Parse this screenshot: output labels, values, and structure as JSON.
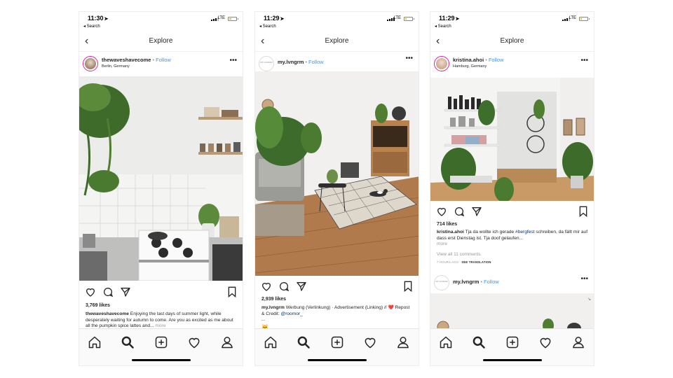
{
  "phones": [
    {
      "status": {
        "time": "11:30",
        "back_label": "◂ Search",
        "network": "LTE"
      },
      "nav": {
        "title": "Explore"
      },
      "post": {
        "username": "thewaveshavecome",
        "follow": "Follow",
        "location": "Berlin, Germany",
        "likes": "3,769 likes",
        "caption_user": "thewaveshavecome",
        "caption_text": "Enjoying the last days of summer light, while desperately waiting for autumn to come. Are you as excited as me about all the pumpkin spice lattes and...",
        "caption_more": "more"
      }
    },
    {
      "status": {
        "time": "11:29",
        "back_label": "◂ Search",
        "network": "LTE"
      },
      "nav": {
        "title": "Explore"
      },
      "post": {
        "username": "my.lvngrm",
        "follow": "Follow",
        "avatar_text": "MY LIVINGR",
        "likes": "2,939 likes",
        "caption_user": "my.lvngrm",
        "caption_text": "Werbung (Verlinkung) · Advertisement (Linking) // ❤️ Repost & Credit:",
        "caption_link": "@roomor_",
        "caption_ellipsis": "...",
        "emoji": "🐱"
      }
    },
    {
      "status": {
        "time": "11:29",
        "back_label": "◂ Search",
        "network": "LTE"
      },
      "nav": {
        "title": "Explore"
      },
      "post": {
        "username": "kristina.ahoi",
        "follow": "Follow",
        "location": "Hamburg, Germany",
        "likes": "714 likes",
        "caption_user": "kristina.ahoi",
        "caption_text_a": "Tja da wollte ich gerade",
        "caption_hashtag": "#bergfest",
        "caption_text_b": "schreiben, da fällt mir auf dass erst Dienstag ist. Tja doof gelaufen...",
        "caption_more": "more",
        "view_comments": "View all 11 comments",
        "time_ago": "7 HOURS AGO",
        "see_translation": "SEE TRANSLATION"
      },
      "next_post": {
        "username": "my.lvngrm",
        "follow": "Follow",
        "avatar_text": "MY LIVINGR"
      }
    }
  ],
  "tabbar": {
    "icons": [
      "home-icon",
      "search-icon",
      "new-post-icon",
      "activity-heart-icon",
      "profile-icon"
    ]
  },
  "colors": {
    "follow_blue": "#3897f0",
    "heart_red": "#ed4956",
    "text": "#262626",
    "muted": "#999999"
  }
}
